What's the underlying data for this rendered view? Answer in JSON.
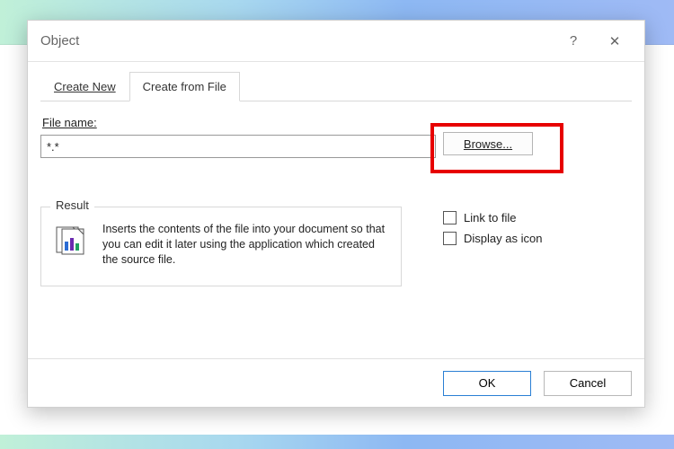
{
  "dialog": {
    "title": "Object",
    "help_label": "?",
    "close_label": "✕"
  },
  "tabs": {
    "create_new": "Create New",
    "create_from_file": "Create from File"
  },
  "file": {
    "label": "File name:",
    "value": "*.*",
    "browse": "Browse..."
  },
  "options": {
    "link_to_file": "Link to file",
    "display_as_icon": "Display as icon"
  },
  "result": {
    "legend": "Result",
    "text": "Inserts the contents of the file into your document so that you can edit it later using the application which created the source file."
  },
  "footer": {
    "ok": "OK",
    "cancel": "Cancel"
  }
}
